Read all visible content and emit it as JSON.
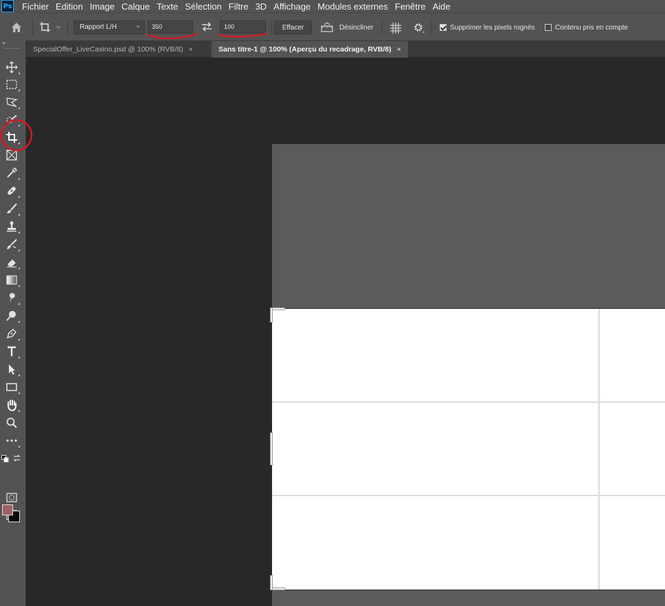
{
  "app": {
    "logo": "Ps"
  },
  "menu": [
    "Fichier",
    "Edition",
    "Image",
    "Calque",
    "Texte",
    "Sélection",
    "Filtre",
    "3D",
    "Affichage",
    "Modules externes",
    "Fenêtre",
    "Aide"
  ],
  "options": {
    "ratio_label": "Rapport L/H",
    "width_value": "350",
    "height_value": "100",
    "clear_label": "Effacer",
    "straighten_label": "Désincliner",
    "delete_pixels_label": "Supprimer les pixels rognés",
    "delete_pixels_checked": true,
    "content_aware_label": "Contenu pris en compte",
    "content_aware_checked": false
  },
  "tabs": [
    {
      "label": "SpecialOffer_LiveCasino.psd @ 100% (RVB/8)",
      "active": false,
      "close": "×"
    },
    {
      "label": "Sans titre-1 @ 100% (Aperçu du recadrage, RVB/8)",
      "active": true,
      "close": "×"
    }
  ],
  "colors": {
    "foreground": "#a05f63",
    "background": "#0a0a0a",
    "annotation": "#e0141e"
  },
  "tools": [
    "move-tool",
    "marquee-tool",
    "lasso-tool",
    "quick-selection-tool",
    "crop-tool",
    "frame-tool",
    "eyedropper-tool",
    "healing-brush-tool",
    "brush-tool",
    "clone-stamp-tool",
    "history-brush-tool",
    "eraser-tool",
    "gradient-tool",
    "smudge-tool",
    "dodge-tool",
    "pen-tool",
    "type-tool",
    "path-selection-tool",
    "rectangle-tool",
    "hand-tool",
    "zoom-tool",
    "more-tools"
  ]
}
